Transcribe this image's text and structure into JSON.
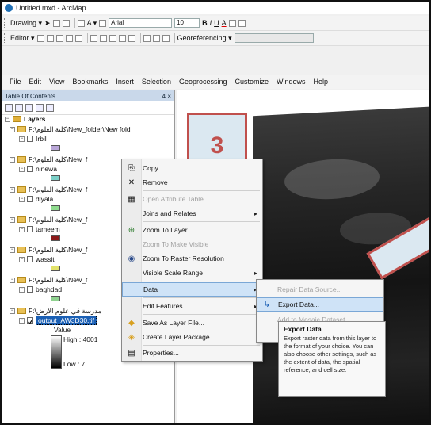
{
  "window": {
    "title": "Untitled.mxd - ArcMap"
  },
  "toolbar1": {
    "drawing_label": "Drawing ▾",
    "font_name": "Arial",
    "font_size": "10",
    "bold": "B",
    "italic": "I",
    "underline": "U",
    "font_color": "A"
  },
  "toolbar2": {
    "editor_label": "Editor ▾",
    "georef_label": "Georeferencing ▾"
  },
  "menubar": [
    "File",
    "Edit",
    "View",
    "Bookmarks",
    "Insert",
    "Selection",
    "Geoprocessing",
    "Customize",
    "Windows",
    "Help"
  ],
  "toc": {
    "title": "Table Of Contents",
    "pin_close": "4 ×",
    "root": "Layers",
    "groups": [
      {
        "folder": "F:\\كلية العلوم\\New_folder\\New fold",
        "layer": "Irbil",
        "color": "#b9a6d8"
      },
      {
        "folder": "F:\\كلية العلوم\\New_f",
        "layer": "ninewa",
        "color": "#7bd0c8"
      },
      {
        "folder": "F:\\كلية العلوم\\New_f",
        "layer": "diyala",
        "color": "#8fdc8f"
      },
      {
        "folder": "F:\\كلية العلوم\\New_f",
        "layer": "tameem",
        "color": "#8b1a1a"
      },
      {
        "folder": "F:\\كلية العلوم\\New_f",
        "layer": "wassit",
        "color": "#e3e36a"
      },
      {
        "folder": "F:\\كلية العلوم\\New_f",
        "layer": "baghdad",
        "color": "#8fd28f"
      }
    ],
    "raster_group": "F:\\مدرسة في علوم الارض",
    "raster_layer": "output_AW3D30.tif",
    "legend_value": "Value",
    "legend_high": "High : 4001",
    "legend_low": "Low : 7"
  },
  "callout": {
    "number": "3"
  },
  "context_menu": {
    "items": [
      {
        "icon": "copy-icon",
        "glyph": "⎘",
        "label": "Copy",
        "disabled": false,
        "submenu": false
      },
      {
        "icon": "remove-icon",
        "glyph": "✕",
        "label": "Remove",
        "disabled": false,
        "submenu": false
      },
      {
        "icon": "attribute-table-icon",
        "glyph": "▦",
        "label": "Open Attribute Table",
        "disabled": true,
        "submenu": false
      },
      {
        "icon": "joins-icon",
        "glyph": "",
        "label": "Joins and Relates",
        "disabled": false,
        "submenu": true
      },
      {
        "icon": "zoom-to-layer-icon",
        "glyph": "⊕",
        "label": "Zoom To Layer",
        "disabled": false,
        "submenu": false
      },
      {
        "icon": "zoom-visible-icon",
        "glyph": "",
        "label": "Zoom To Make Visible",
        "disabled": true,
        "submenu": false
      },
      {
        "icon": "zoom-raster-icon",
        "glyph": "◉",
        "label": "Zoom To Raster Resolution",
        "disabled": false,
        "submenu": false
      },
      {
        "icon": "scale-range-icon",
        "glyph": "",
        "label": "Visible Scale Range",
        "disabled": false,
        "submenu": true
      },
      {
        "icon": "data-icon",
        "glyph": "",
        "label": "Data",
        "disabled": false,
        "submenu": true,
        "highlight": true
      },
      {
        "icon": "edit-features-icon",
        "glyph": "",
        "label": "Edit Features",
        "disabled": false,
        "submenu": true
      },
      {
        "icon": "save-layer-icon",
        "glyph": "◆",
        "label": "Save As Layer File...",
        "disabled": false,
        "submenu": false
      },
      {
        "icon": "layer-package-icon",
        "glyph": "◈",
        "label": "Create Layer Package...",
        "disabled": false,
        "submenu": false
      },
      {
        "icon": "properties-icon",
        "glyph": "▤",
        "label": "Properties...",
        "disabled": false,
        "submenu": false
      }
    ]
  },
  "data_submenu": {
    "items": [
      {
        "icon": "repair-source-icon",
        "glyph": "",
        "label": "Repair Data Source...",
        "disabled": true,
        "highlight": false
      },
      {
        "icon": "export-data-icon",
        "glyph": "↳",
        "label": "Export Data...",
        "disabled": false,
        "highlight": true
      },
      {
        "icon": "mosaic-icon",
        "glyph": "",
        "label": "Add to Mosaic Dataset",
        "disabled": true,
        "highlight": false
      }
    ]
  },
  "tooltip": {
    "title": "Export Data",
    "body": "Export raster data from this layer to the format of your choice. You can also choose other settings, such as the extent of data, the spatial reference, and cell size."
  }
}
